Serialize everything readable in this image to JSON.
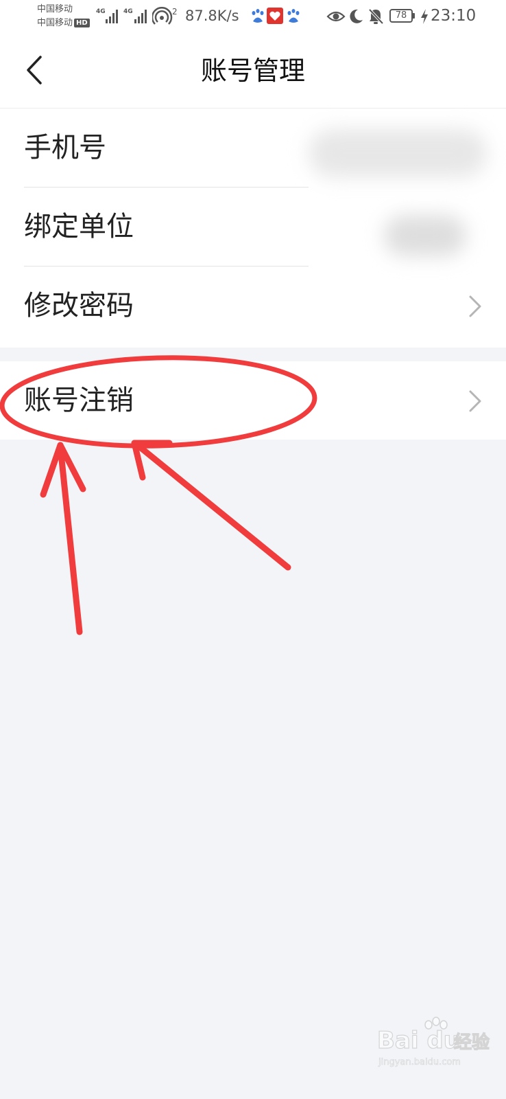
{
  "status_bar": {
    "carrier_1": "中国移动",
    "carrier_2": "中国移动",
    "hd_badge": "HD",
    "network_1": "4G",
    "network_2": "4G",
    "hotspot_count": "2",
    "net_speed": "87.8K/s",
    "battery": "78",
    "time": "23:10",
    "icons": [
      "signal-bars-icon",
      "wifi-hotspot-icon",
      "baidu-paw-icon",
      "app-red-icon",
      "eye-icon",
      "moon-icon",
      "bell-muted-icon",
      "charging-bolt-icon"
    ]
  },
  "nav": {
    "title": "账号管理",
    "back_icon": "chevron-left-icon"
  },
  "settings": {
    "group_1": [
      {
        "label": "手机号",
        "value_hidden": true
      },
      {
        "label": "绑定单位",
        "value_hidden": true
      },
      {
        "label": "修改密码",
        "chevron": true
      }
    ],
    "group_2": [
      {
        "label": "账号注销",
        "chevron": true
      }
    ]
  },
  "annotation": {
    "color": "#f03c3c",
    "shapes": [
      "highlight-ellipse",
      "pointer-arrow",
      "pointer-arrow"
    ]
  },
  "watermark": {
    "brand": "Bai du",
    "sub": "经验",
    "url": "jingyan.baidu.com"
  },
  "colors": {
    "background": "#f3f4f7",
    "surface": "#ffffff",
    "divider": "#e3e3e3",
    "text": "#222222",
    "chevron": "#b5b5b5",
    "annotation_red": "#f03c3c"
  }
}
